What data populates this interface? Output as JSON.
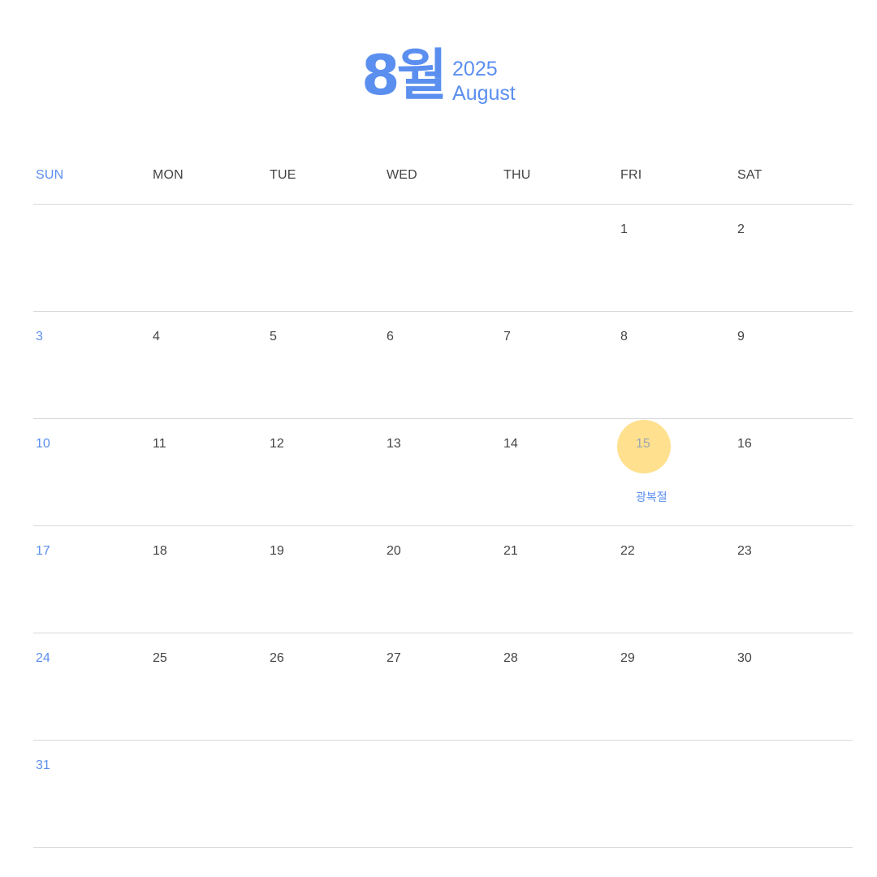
{
  "header": {
    "month_ko": "8월",
    "year": "2025",
    "month_en": "August"
  },
  "colors": {
    "accent": "#5b8fef",
    "highlight": "#ffe08f",
    "text": "#444444",
    "line": "#d9d9d9"
  },
  "weekdays": [
    "SUN",
    "MON",
    "TUE",
    "WED",
    "THU",
    "FRI",
    "SAT"
  ],
  "weeks": [
    [
      "",
      "",
      "",
      "",
      "",
      "1",
      "2"
    ],
    [
      "3",
      "4",
      "5",
      "6",
      "7",
      "8",
      "9"
    ],
    [
      "10",
      "11",
      "12",
      "13",
      "14",
      "15",
      "16"
    ],
    [
      "17",
      "18",
      "19",
      "20",
      "21",
      "22",
      "23"
    ],
    [
      "24",
      "25",
      "26",
      "27",
      "28",
      "29",
      "30"
    ],
    [
      "31",
      "",
      "",
      "",
      "",
      "",
      ""
    ]
  ],
  "events": {
    "holiday_day": "15",
    "holiday_name": "광복절"
  }
}
